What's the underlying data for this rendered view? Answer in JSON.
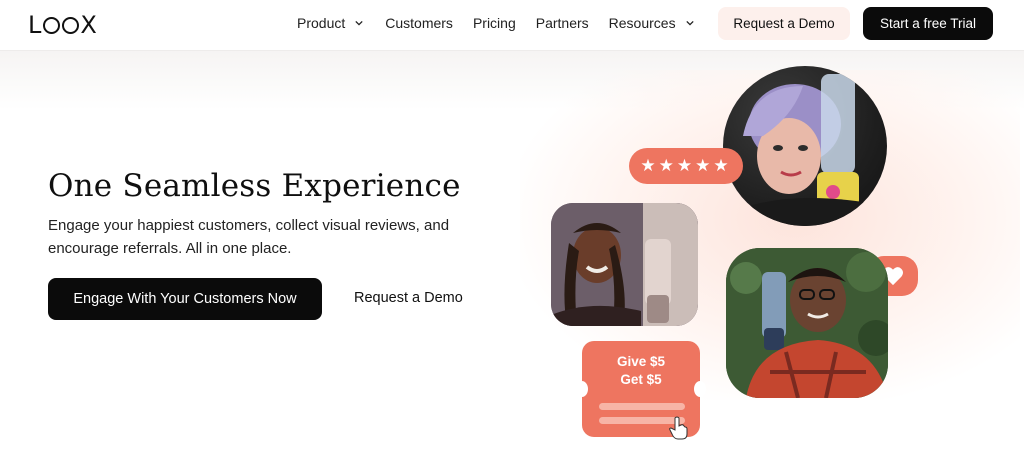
{
  "header": {
    "logo_text": "LOOX",
    "nav": {
      "product": "Product",
      "customers": "Customers",
      "pricing": "Pricing",
      "partners": "Partners",
      "resources": "Resources"
    },
    "request_demo": "Request a Demo",
    "start_trial": "Start a free Trial"
  },
  "hero": {
    "title": "One Seamless Experience",
    "subtitle": "Engage your happiest customers, collect visual reviews, and encourage referrals. All in one place.",
    "cta_primary": "Engage With Your Customers Now",
    "cta_secondary": "Request a Demo"
  },
  "collage": {
    "stars": "★★★★★",
    "referral_line1": "Give $5",
    "referral_line2": "Get $5"
  },
  "colors": {
    "accent": "#ee7560",
    "dark": "#0b0b0b",
    "soft_pink": "#fdf0ec"
  }
}
